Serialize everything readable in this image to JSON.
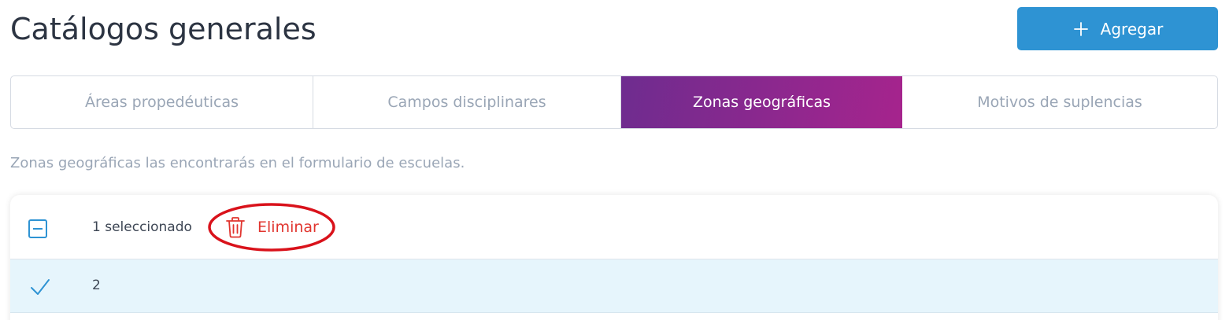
{
  "header": {
    "title": "Catálogos generales",
    "add_label": "Agregar"
  },
  "tabs": [
    {
      "label": "Áreas propedéuticas",
      "active": false
    },
    {
      "label": "Campos disciplinares",
      "active": false
    },
    {
      "label": "Zonas geográficas",
      "active": true
    },
    {
      "label": "Motivos de suplencias",
      "active": false
    }
  ],
  "subtitle": "Zonas geográficas las encontrarás en el formulario de escuelas.",
  "table": {
    "selection_text": "1 seleccionado",
    "delete_label": "Eliminar",
    "rows": [
      {
        "value": "2",
        "selected": true
      }
    ]
  },
  "colors": {
    "primary": "#2e93d3",
    "danger": "#e1352f",
    "tab_gradient_start": "#6e2c8f",
    "tab_gradient_end": "#a6248d",
    "selected_row": "#e6f5fc"
  },
  "icons": {
    "add": "plus-icon",
    "delete": "trash-icon",
    "select_all": "indeterminate-checkbox",
    "row_selected": "checkmark-icon"
  }
}
